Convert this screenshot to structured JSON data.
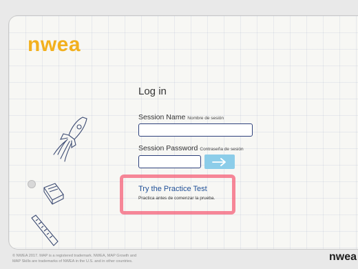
{
  "brand": {
    "logo_text": "nwea",
    "logo_color": "#f2b01e",
    "footer_logo_text": "nwea"
  },
  "login": {
    "title": "Log in",
    "session_name_label": "Session Name",
    "session_name_sublabel": "Nombre de sesión",
    "session_name_value": "",
    "session_password_label": "Session Password",
    "session_password_sublabel": "Contraseña de sesión",
    "session_password_value": "",
    "submit_icon": "arrow-right-icon"
  },
  "practice": {
    "link_text": "Try the Practice Test",
    "subtext": "Practica antes de comenzar la prueba.",
    "highlight_color": "#f55a73"
  },
  "footer": {
    "line1": "© NWEA 2017. MAP is a registered trademark. NWEA, MAP Growth and",
    "line2": "MAP Skills are trademarks of NWEA in the U.S. and in other countries."
  },
  "decorations": {
    "icons": [
      "rocket-doodle-icon",
      "book-doodle-icon",
      "ruler-doodle-icon"
    ]
  }
}
